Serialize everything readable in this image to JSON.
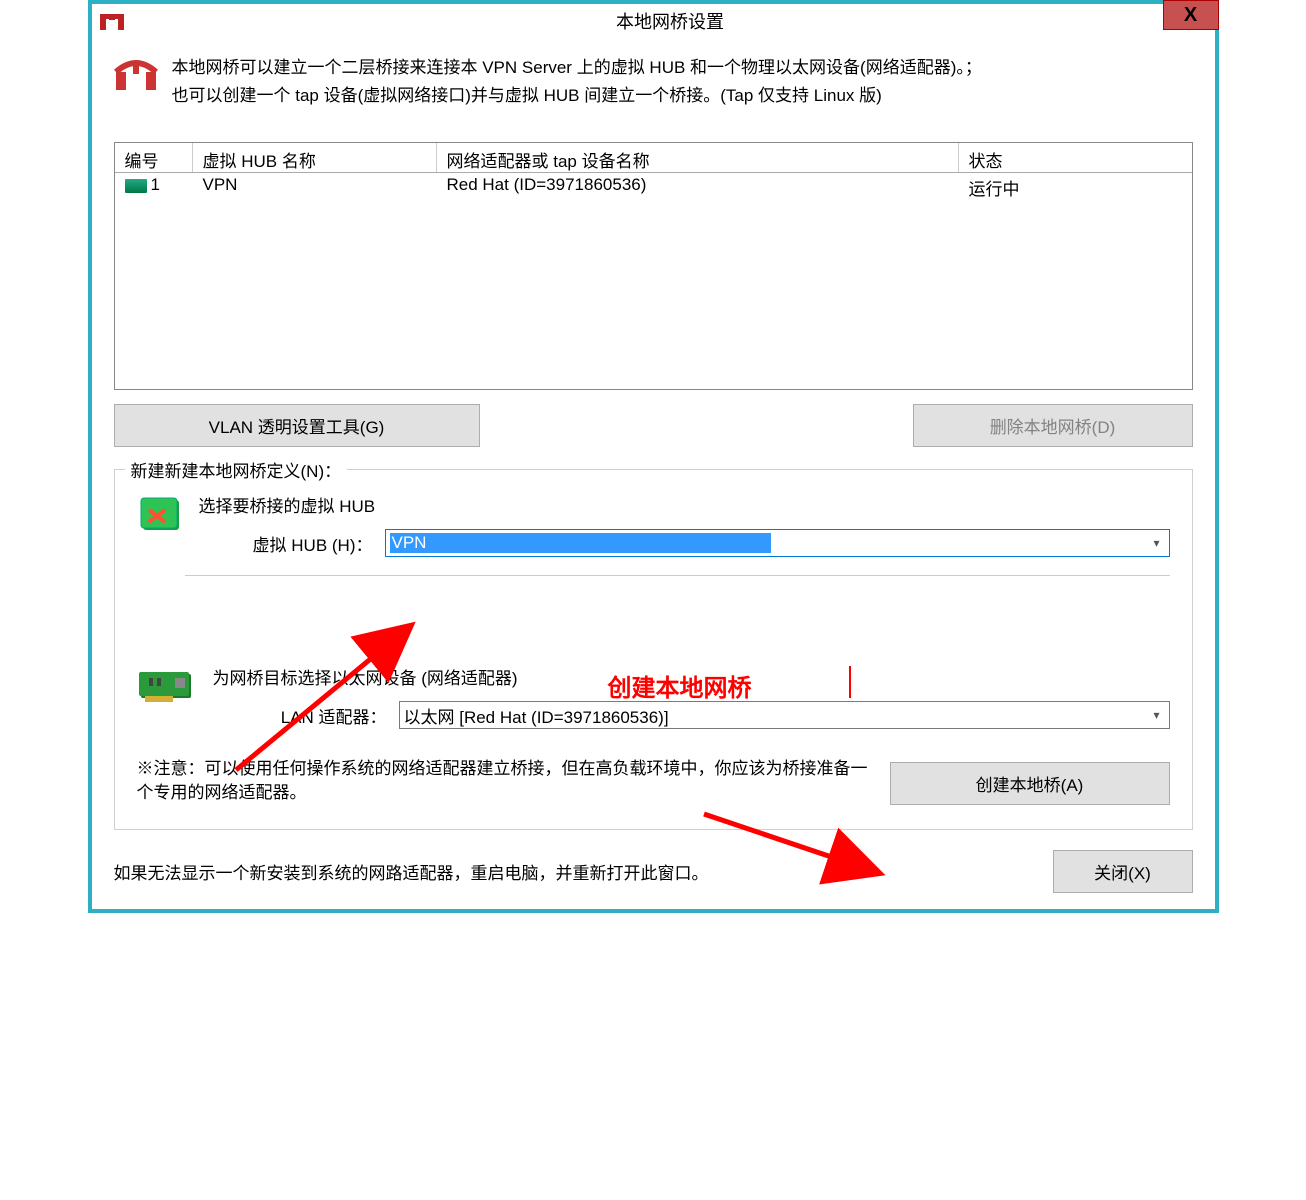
{
  "window": {
    "title": "本地网桥设置"
  },
  "intro": {
    "line1": "本地网桥可以建立一个二层桥接来连接本 VPN Server 上的虚拟 HUB 和一个物理以太网设备(网络适配器)。；",
    "line2": "也可以创建一个 tap 设备(虚拟网络接口)并与虚拟 HUB 间建立一个桥接。(Tap 仅支持 Linux 版)"
  },
  "table": {
    "cols": {
      "c1": "编号",
      "c2": "虚拟 HUB 名称",
      "c3": "网络适配器或 tap 设备名称",
      "c4": "状态"
    },
    "rows": [
      {
        "num": "1",
        "hub": "VPN",
        "adapter": "Red Hat (ID=3971860536)",
        "status": "运行中"
      }
    ]
  },
  "buttons": {
    "vlan": "VLAN 透明设置工具(G)",
    "delete": "删除本地网桥(D)",
    "create": "创建本地桥(A)",
    "close": "关闭(X)"
  },
  "group": {
    "title": "新建新建本地网桥定义(N)：",
    "hubHead": "选择要桥接的虚拟 HUB",
    "hubLabel": "虚拟 HUB (H)：",
    "hubValue": "VPN",
    "nicHead": "为网桥目标选择以太网设备 (网络适配器)",
    "nicLabel": "LAN 适配器：",
    "nicValue": "以太网 [Red Hat (ID=3971860536)]",
    "note": "※注意：可以使用任何操作系统的网络适配器建立桥接，但在高负载环境中，你应该为桥接准备一个专用的网络适配器。"
  },
  "footer": "如果无法显示一个新安装到系统的网路适配器，重启电脑，并重新打开此窗口。",
  "annotation": "创建本地网桥"
}
